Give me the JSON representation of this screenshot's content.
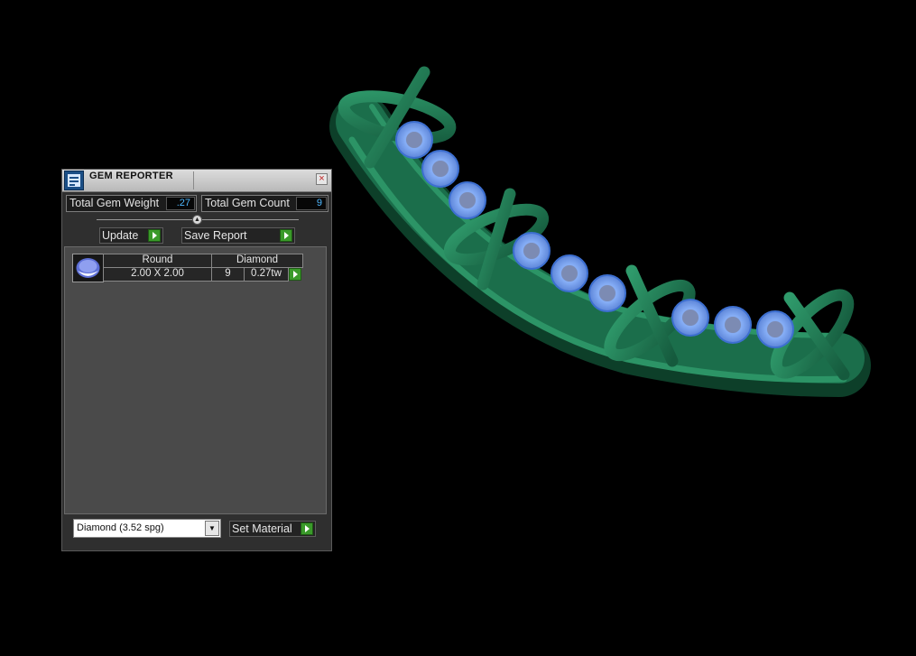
{
  "panel": {
    "title": "GEM REPORTER",
    "close_glyph": "×",
    "total_weight_label": "Total Gem Weight",
    "total_weight_value": ".27",
    "total_count_label": "Total Gem Count",
    "total_count_value": "9",
    "splitter_glyph": "▲",
    "update_label": "Update",
    "save_report_label": "Save Report",
    "gems": [
      {
        "shape": "Round",
        "size": "2.00 X 2.00",
        "material": "Diamond",
        "count": "9",
        "weight": "0.27tw"
      }
    ],
    "material_select": {
      "value": "Diamond     (3.52 spg)",
      "dropdown_glyph": "▼"
    },
    "set_material_label": "Set Material"
  },
  "icons": {
    "app": "gem-reporter-app-icon",
    "close": "close-icon",
    "arrow": "play-arrow-icon",
    "gem": "round-gem-icon",
    "dropdown": "chevron-down-icon"
  },
  "colors": {
    "background": "#000000",
    "metal": "#1f7a55",
    "gem": "#7aa8f2",
    "value_text": "#4fb8ff",
    "action_arrow": "#3a9a2a"
  }
}
